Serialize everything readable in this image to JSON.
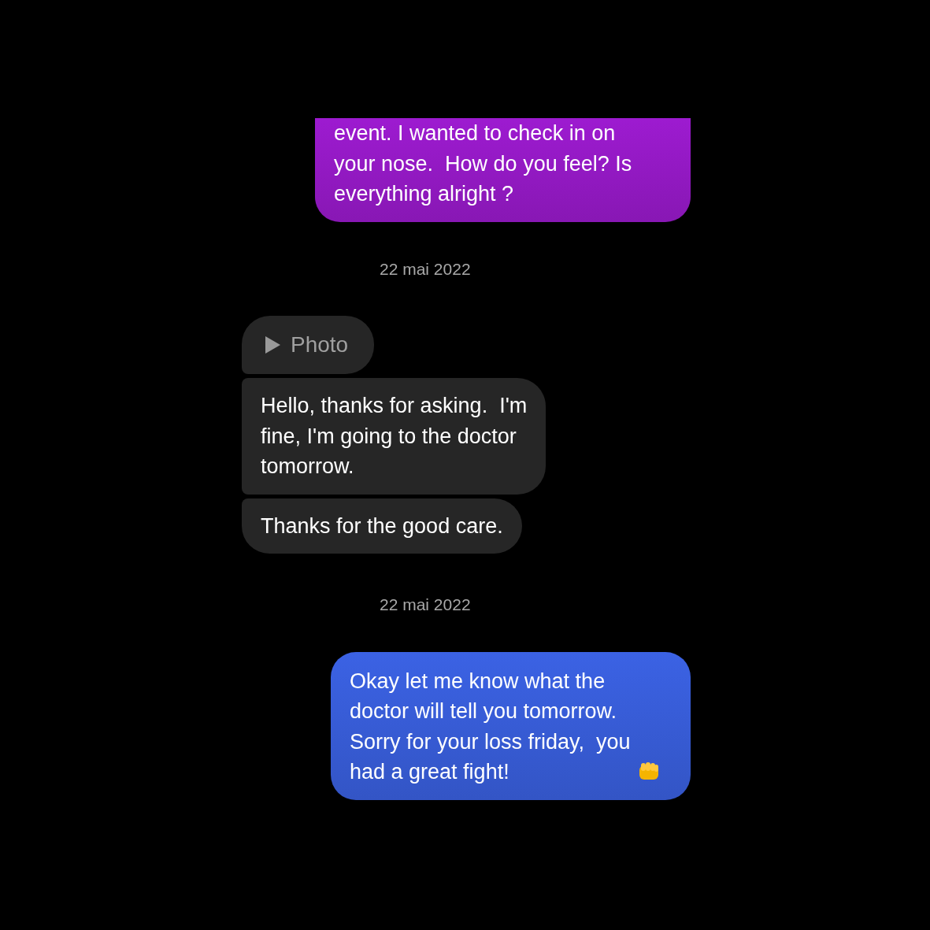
{
  "messages": [
    {
      "kind": "sent",
      "color": "#9d1bd0",
      "cut_top": true,
      "text": "event. I wanted to check in on\nyour nose.  How do you feel? Is\neverything alright ?"
    },
    {
      "kind": "date",
      "text": "22 mai 2022"
    },
    {
      "kind": "photo",
      "text": "Photo"
    },
    {
      "kind": "received",
      "text": "Hello, thanks for asking.  I'm\nfine, I'm going to the doctor\ntomorrow."
    },
    {
      "kind": "received",
      "text": "Thanks for the good care."
    },
    {
      "kind": "date",
      "text": "22 mai 2022"
    },
    {
      "kind": "sent",
      "color": "#3b62e4",
      "cut_top": false,
      "text": "Okay let me know what the\ndoctor will tell you tomorrow.\nSorry for your loss friday,  you\nhad a great fight!"
    }
  ]
}
